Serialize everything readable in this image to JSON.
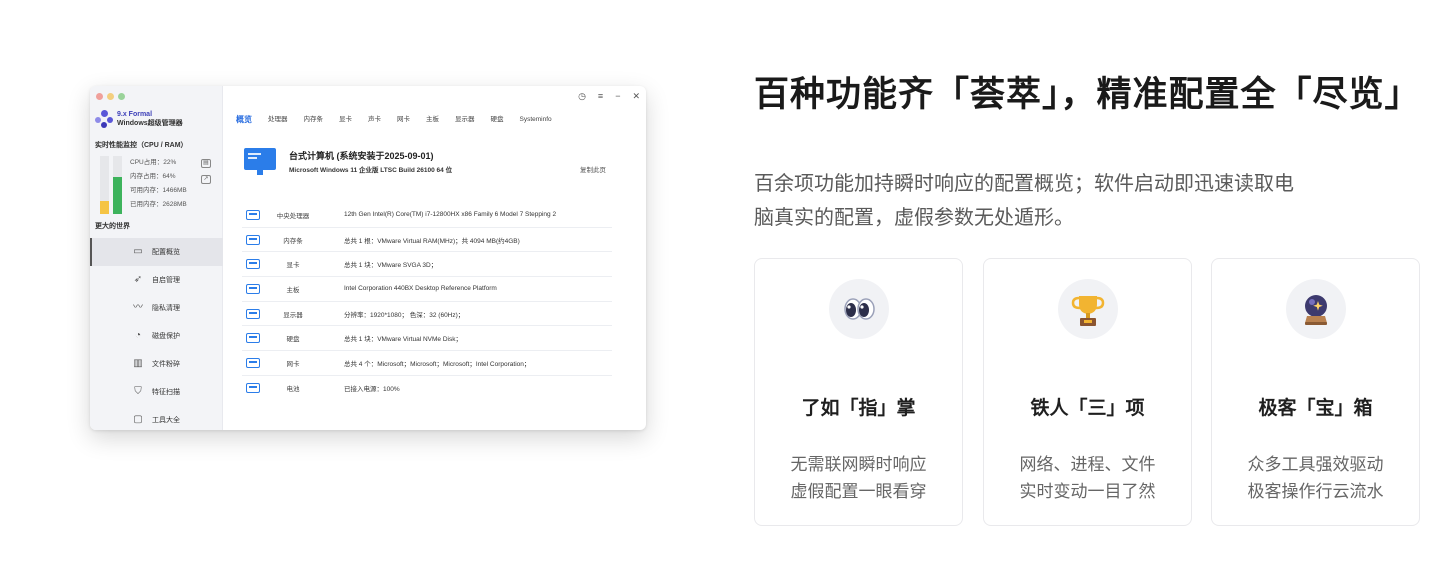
{
  "app": {
    "version": "9.x Formal",
    "name": "Windows超级管理器",
    "monitor_title": "实时性能监控（CPU / RAM）",
    "cpu_level": 0.22,
    "ram_level": 0.64,
    "cpu_color": "#f5c445",
    "ram_color": "#3db35c",
    "stats": {
      "cpu": "CPU占用：22%",
      "ram": "内存占用：64%",
      "avail": "可用内存：1466MB",
      "used": "已用内存：2628MB"
    },
    "section_title": "更大的世界",
    "nav": [
      {
        "label": "配置概览",
        "icon": "config-icon"
      },
      {
        "label": "自启管理",
        "icon": "rocket-icon"
      },
      {
        "label": "隐私清理",
        "icon": "privacy-icon"
      },
      {
        "label": "磁盘保护",
        "icon": "disk-icon"
      },
      {
        "label": "文件粉碎",
        "icon": "trash-icon"
      },
      {
        "label": "特征扫描",
        "icon": "shield-icon"
      },
      {
        "label": "工具大全",
        "icon": "toolbox-icon"
      }
    ],
    "tabs": [
      "概览",
      "处理器",
      "内存条",
      "显卡",
      "声卡",
      "网卡",
      "主板",
      "显示器",
      "硬盘",
      "Systeminfo"
    ],
    "pc_title": "台式计算机 (系统安装于2025-09-01)",
    "pc_os": "Microsoft Windows 11 企业版 LTSC Build 26100 64 位",
    "pc_link": "复制此页",
    "specs": [
      {
        "label": "中央处理器",
        "value": "12th Gen Intel(R) Core(TM) i7-12800HX x86 Family 6 Model 7 Stepping 2"
      },
      {
        "label": "内存条",
        "value": "总共 1 根：VMware Virtual RAM(MHz)；共 4094 MB(约4GB)"
      },
      {
        "label": "显卡",
        "value": "总共 1 块：VMware SVGA 3D；"
      },
      {
        "label": "主板",
        "value": "Intel Corporation  440BX Desktop Reference Platform"
      },
      {
        "label": "显示器",
        "value": "分辨率：1920*1080；  色深：32  (60Hz)；"
      },
      {
        "label": "硬盘",
        "value": "总共 1 块：VMware Virtual NVMe Disk；"
      },
      {
        "label": "网卡",
        "value": "总共 4 个：Microsoft；Microsoft；Microsoft；Intel Corporation；"
      },
      {
        "label": "电池",
        "value": "已接入电源：100%"
      }
    ]
  },
  "hero": {
    "headline": "百种功能齐「荟萃」，精准配置全「尽览」",
    "desc_line1": "百余项功能加持瞬时响应的配置概览；软件启动即迅速读取电",
    "desc_line2": "脑真实的配置，虚假参数无处遁形。"
  },
  "cards": [
    {
      "icon": "eyes-icon",
      "title": "了如「指」掌",
      "line1": "无需联网瞬时响应",
      "line2": "虚假配置一眼看穿"
    },
    {
      "icon": "trophy-icon",
      "title": "铁人「三」项",
      "line1": "网络、进程、文件",
      "line2": "实时变动一目了然"
    },
    {
      "icon": "crystal-ball-icon",
      "title": "极客「宝」箱",
      "line1": "众多工具强效驱动",
      "line2": "极客操作行云流水"
    }
  ]
}
